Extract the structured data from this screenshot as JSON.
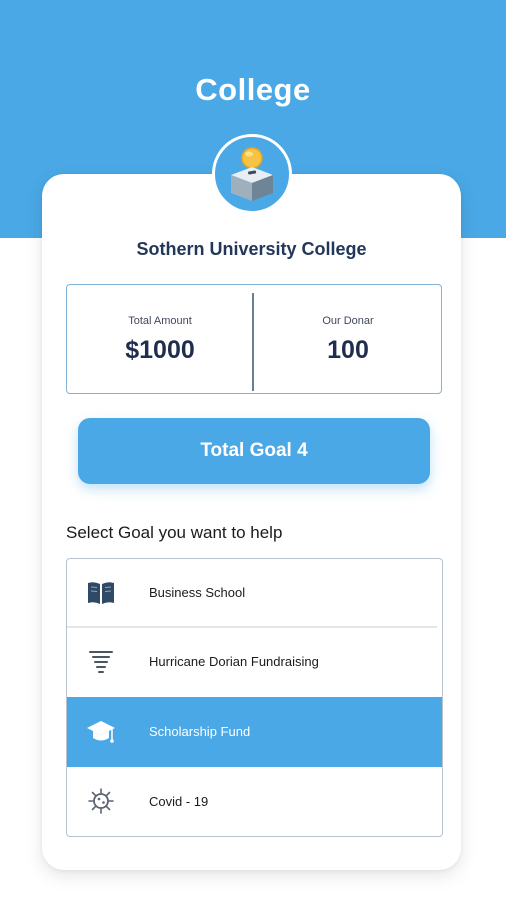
{
  "header": {
    "title": "College"
  },
  "college": {
    "name": "Sothern University College"
  },
  "stats": {
    "total_amount_label": "Total Amount",
    "total_amount_value": "$1000",
    "donors_label": "Our Donar",
    "donors_value": "100"
  },
  "goal_button": {
    "label": "Total Goal 4"
  },
  "goals_section": {
    "heading": "Select Goal you want to help",
    "selected_index": 2,
    "items": [
      {
        "label": "Business School",
        "icon": "book-icon"
      },
      {
        "label": "Hurricane Dorian Fundraising",
        "icon": "tornado-icon"
      },
      {
        "label": "Scholarship Fund",
        "icon": "graduation-cap-icon"
      },
      {
        "label": "Covid - 19",
        "icon": "virus-icon"
      }
    ]
  },
  "colors": {
    "primary": "#4aa8e6",
    "heading_text": "#22375a",
    "card_background": "#ffffff"
  }
}
